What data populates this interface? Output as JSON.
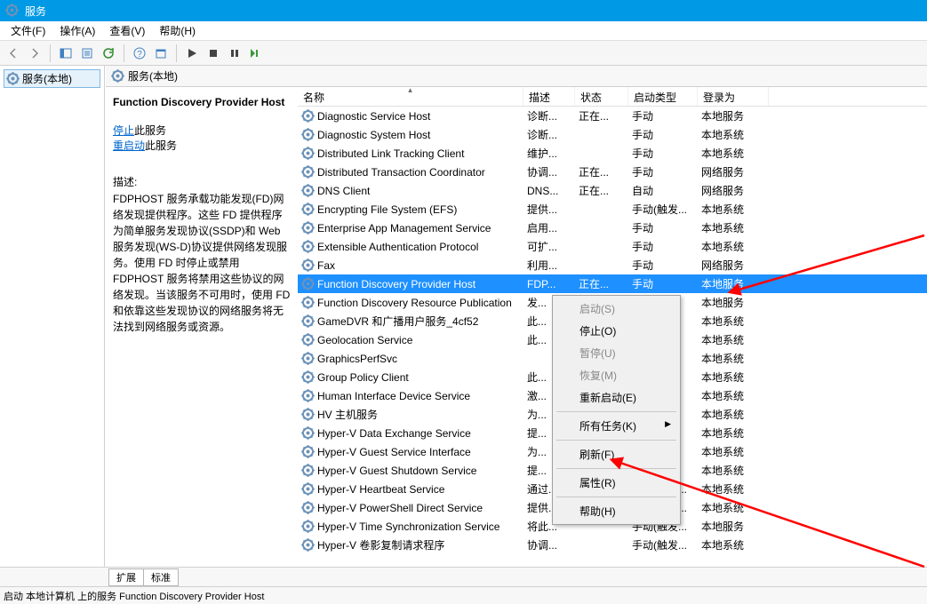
{
  "title_bar": {
    "app_name": "服务"
  },
  "menus": {
    "file": "文件(F)",
    "action": "操作(A)",
    "view": "查看(V)",
    "help": "帮助(H)"
  },
  "tree": {
    "root": "服务(本地)"
  },
  "pane_header": "服务(本地)",
  "details": {
    "title": "Function Discovery Provider Host",
    "stop_link": "停止",
    "stop_suffix": "此服务",
    "restart_link": "重启动",
    "restart_suffix": "此服务",
    "desc_label": "描述:",
    "desc": "FDPHOST 服务承载功能发现(FD)网络发现提供程序。这些 FD 提供程序为简单服务发现协议(SSDP)和 Web 服务发现(WS-D)协议提供网络发现服务。使用 FD 时停止或禁用 FDPHOST 服务将禁用这些协议的网络发现。当该服务不可用时，使用 FD 和依靠这些发现协议的网络服务将无法找到网络服务或资源。"
  },
  "columns": {
    "name": "名称",
    "desc": "描述",
    "status": "状态",
    "start": "启动类型",
    "logon": "登录为"
  },
  "services": [
    {
      "name": "Diagnostic Service Host",
      "desc": "诊断...",
      "status": "正在...",
      "start": "手动",
      "logon": "本地服务"
    },
    {
      "name": "Diagnostic System Host",
      "desc": "诊断...",
      "status": "",
      "start": "手动",
      "logon": "本地系统"
    },
    {
      "name": "Distributed Link Tracking Client",
      "desc": "维护...",
      "status": "",
      "start": "手动",
      "logon": "本地系统"
    },
    {
      "name": "Distributed Transaction Coordinator",
      "desc": "协调...",
      "status": "正在...",
      "start": "手动",
      "logon": "网络服务"
    },
    {
      "name": "DNS Client",
      "desc": "DNS...",
      "status": "正在...",
      "start": "自动",
      "logon": "网络服务"
    },
    {
      "name": "Encrypting File System (EFS)",
      "desc": "提供...",
      "status": "",
      "start": "手动(触发...",
      "logon": "本地系统"
    },
    {
      "name": "Enterprise App Management Service",
      "desc": "启用...",
      "status": "",
      "start": "手动",
      "logon": "本地系统"
    },
    {
      "name": "Extensible Authentication Protocol",
      "desc": "可扩...",
      "status": "",
      "start": "手动",
      "logon": "本地系统"
    },
    {
      "name": "Fax",
      "desc": "利用...",
      "status": "",
      "start": "手动",
      "logon": "网络服务"
    },
    {
      "name": "Function Discovery Provider Host",
      "desc": "FDP...",
      "status": "正在...",
      "start": "手动",
      "logon": "本地服务",
      "selected": true
    },
    {
      "name": "Function Discovery Resource Publication",
      "desc": "发...",
      "status": "",
      "start": "",
      "logon": "本地服务"
    },
    {
      "name": "GameDVR 和广播用户服务_4cf52",
      "desc": "此...",
      "status": "",
      "start": "",
      "logon": "本地系统"
    },
    {
      "name": "Geolocation Service",
      "desc": "此...",
      "status": "",
      "start": "",
      "logon": "本地系统"
    },
    {
      "name": "GraphicsPerfSvc",
      "desc": "",
      "status": "",
      "start": "",
      "logon": "本地系统"
    },
    {
      "name": "Group Policy Client",
      "desc": "此...",
      "status": "",
      "start": "",
      "logon": "本地系统"
    },
    {
      "name": "Human Interface Device Service",
      "desc": "激...",
      "status": "",
      "start": "",
      "logon": "本地系统"
    },
    {
      "name": "HV 主机服务",
      "desc": "为...",
      "status": "",
      "start": "",
      "logon": "本地系统"
    },
    {
      "name": "Hyper-V Data Exchange Service",
      "desc": "提...",
      "status": "",
      "start": "",
      "logon": "本地系统"
    },
    {
      "name": "Hyper-V Guest Service Interface",
      "desc": "为...",
      "status": "",
      "start": "",
      "logon": "本地系统"
    },
    {
      "name": "Hyper-V Guest Shutdown Service",
      "desc": "提...",
      "status": "",
      "start": "",
      "logon": "本地系统"
    },
    {
      "name": "Hyper-V Heartbeat Service",
      "desc": "通过...",
      "status": "",
      "start": "手动(触发...",
      "logon": "本地系统"
    },
    {
      "name": "Hyper-V PowerShell Direct Service",
      "desc": "提供...",
      "status": "",
      "start": "手动(触发...",
      "logon": "本地系统"
    },
    {
      "name": "Hyper-V Time Synchronization Service",
      "desc": "将此...",
      "status": "",
      "start": "手动(触发...",
      "logon": "本地服务"
    },
    {
      "name": "Hyper-V 卷影复制请求程序",
      "desc": "协调...",
      "status": "",
      "start": "手动(触发...",
      "logon": "本地系统"
    }
  ],
  "context_menu": {
    "start": "启动(S)",
    "stop": "停止(O)",
    "pause": "暂停(U)",
    "resume": "恢复(M)",
    "restart": "重新启动(E)",
    "all_tasks": "所有任务(K)",
    "refresh": "刷新(F)",
    "properties": "属性(R)",
    "help": "帮助(H)"
  },
  "tabs": {
    "ext": "扩展",
    "std": "标准"
  },
  "status_bar": "启动 本地计算机 上的服务 Function Discovery Provider Host"
}
